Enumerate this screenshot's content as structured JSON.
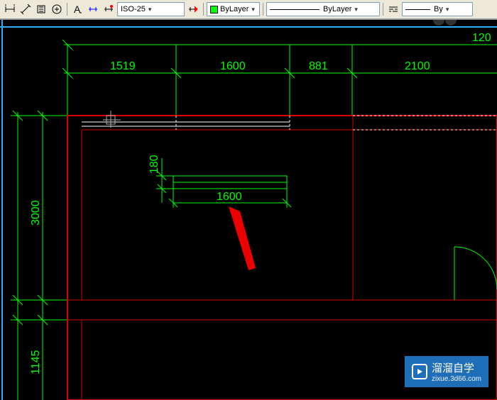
{
  "toolbar": {
    "dim_style": "ISO-25",
    "color_label": "ByLayer",
    "linetype_label": "ByLayer",
    "lineweight_label": "By"
  },
  "dimensions": {
    "top_right_partial": "120",
    "top_dims": [
      "1519",
      "1600",
      "881",
      "2100"
    ],
    "left_dim_upper": "3000",
    "left_dim_lower": "1145",
    "rect_height": "180",
    "rect_width": "1600"
  },
  "watermark": {
    "main": "溜溜自学",
    "sub": "zixue.3d66.com"
  }
}
